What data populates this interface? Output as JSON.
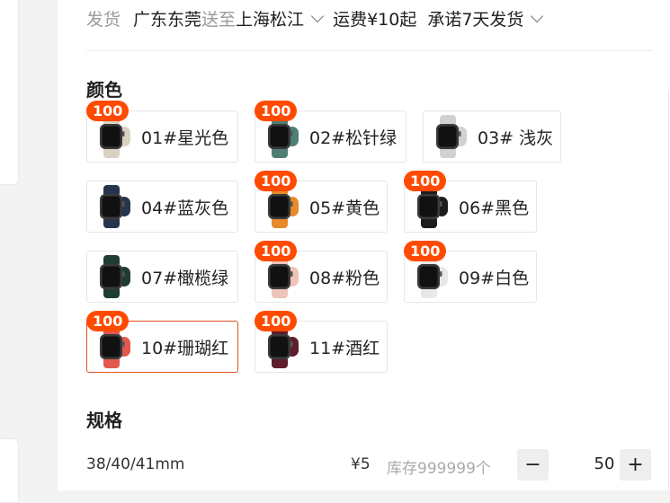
{
  "shipping": {
    "from_label": "发货",
    "from_city": "广东东莞",
    "to_label": "送至",
    "to_city": "上海松江",
    "fee": "运费¥10起",
    "promise": "承诺7天发货"
  },
  "color_section": {
    "title": "颜色",
    "options": [
      {
        "label": "01#星光色",
        "badge": "100",
        "band_color": "#d9d2c3",
        "selected": false
      },
      {
        "label": "02#松针绿",
        "badge": "100",
        "band_color": "#4f7e74",
        "selected": false
      },
      {
        "label": "03# 浅灰",
        "badge": "",
        "band_color": "#cfd1d3",
        "selected": false
      },
      {
        "label": "04#蓝灰色",
        "badge": "",
        "band_color": "#27344d",
        "selected": false
      },
      {
        "label": "05#黄色",
        "badge": "100",
        "band_color": "#e8892a",
        "selected": false
      },
      {
        "label": "06#黑色",
        "badge": "100",
        "band_color": "#1d1d1d",
        "selected": false
      },
      {
        "label": "07#橄榄绿",
        "badge": "",
        "band_color": "#1f3d35",
        "selected": false
      },
      {
        "label": "08#粉色",
        "badge": "100",
        "band_color": "#ecc4b8",
        "selected": false
      },
      {
        "label": "09#白色",
        "badge": "100",
        "band_color": "#e8e8e8",
        "selected": false
      },
      {
        "label": "10#珊瑚红",
        "badge": "100",
        "band_color": "#e2584e",
        "selected": true
      },
      {
        "label": "11#酒红",
        "badge": "100",
        "band_color": "#5e1d2c",
        "selected": false
      }
    ]
  },
  "spec_section": {
    "title": "规格",
    "rows": [
      {
        "name": "38/40/41mm",
        "price": "¥5",
        "stock": "库存999999个",
        "quantity": "50",
        "minus": "−",
        "plus": "+"
      }
    ]
  },
  "colors": {
    "badge": "#ff4a00",
    "selected_border": "#e0521f"
  }
}
